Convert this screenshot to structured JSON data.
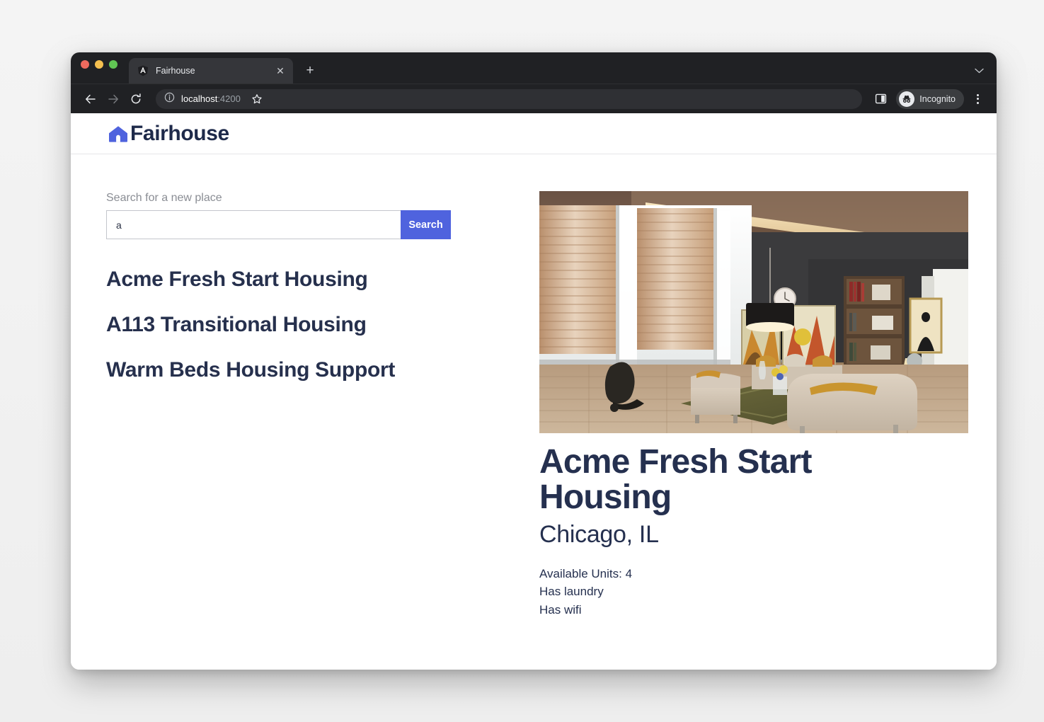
{
  "browser": {
    "tab": {
      "title": "Fairhouse",
      "favicon_name": "angular-logo-icon",
      "close_label": "✕"
    },
    "new_tab_label": "+",
    "tab_list_chevron": "⌄",
    "toolbar": {
      "back_label": "←",
      "forward_label": "→",
      "reload_label": "⟳",
      "site_info_icon": "info-circle-icon",
      "url_host": "localhost",
      "url_port": ":4200",
      "bookmark_label": "☆",
      "side_panel_icon": "split-panel-icon",
      "profile_label": "Incognito",
      "menu_icon": "kebab-menu-icon"
    }
  },
  "app": {
    "brand": {
      "name": "Fairhouse",
      "logo_name": "house-logo-icon",
      "logo_color": "#4f63de",
      "text_color": "#1e2a4a"
    },
    "search": {
      "label": "Search for a new place",
      "value": "a",
      "placeholder": "",
      "button_label": "Search",
      "button_color": "#4f63de"
    },
    "results": [
      {
        "name": "Acme Fresh Start Housing"
      },
      {
        "name": "A113 Transitional Housing"
      },
      {
        "name": "Warm Beds Housing Support"
      }
    ],
    "detail": {
      "photo_alt": "living-room-photo",
      "title": "Acme Fresh Start Housing",
      "location": "Chicago, IL",
      "facts": [
        "Available Units: 4",
        "Has laundry",
        "Has wifi"
      ]
    }
  }
}
